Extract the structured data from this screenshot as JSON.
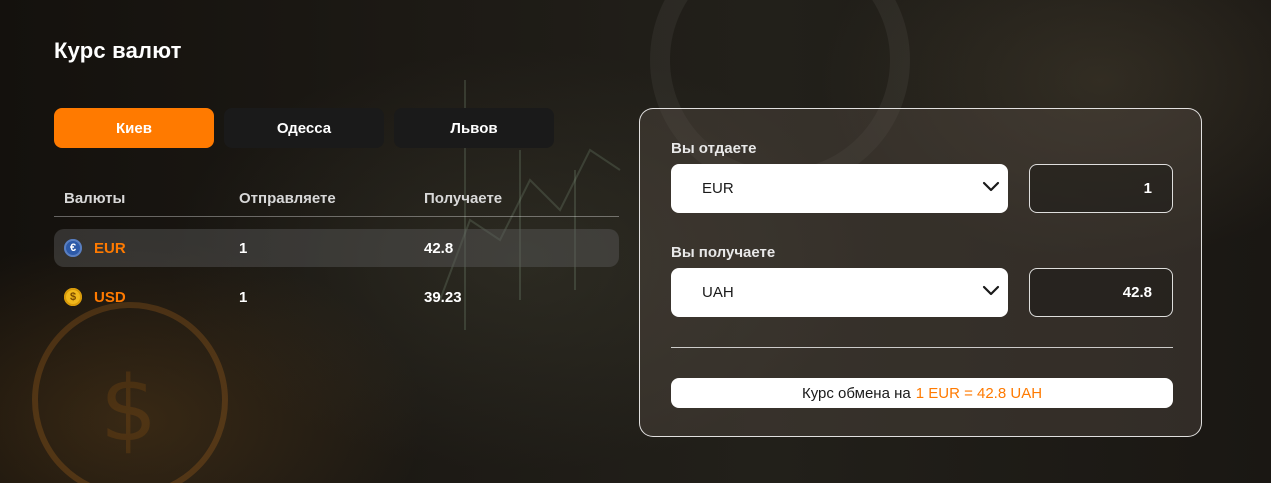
{
  "title": "Курс валют",
  "tabs": [
    {
      "label": "Киев",
      "active": true
    },
    {
      "label": "Одесса",
      "active": false
    },
    {
      "label": "Львов",
      "active": false
    }
  ],
  "table": {
    "headers": [
      "Валюты",
      "Отправляете",
      "Получаете"
    ],
    "rows": [
      {
        "icon": "euro-coin-icon",
        "icon_glyph": "€",
        "currency": "EUR",
        "send": "1",
        "receive": "42.8",
        "selected": true
      },
      {
        "icon": "dollar-coin-icon",
        "icon_glyph": "$",
        "currency": "USD",
        "send": "1",
        "receive": "39.23",
        "selected": false
      }
    ]
  },
  "converter": {
    "give_label": "Вы отдаете",
    "give_currency": "EUR",
    "give_amount": "1",
    "get_label": "Вы получаете",
    "get_currency": "UAH",
    "get_amount": "42.8",
    "rate_prefix": "Курс обмена на",
    "rate_value": "1 EUR = 42.8 UAH"
  },
  "colors": {
    "accent": "#ff7a00",
    "tab_inactive": "#1a1a1a",
    "panel_border": "#ffffff"
  }
}
